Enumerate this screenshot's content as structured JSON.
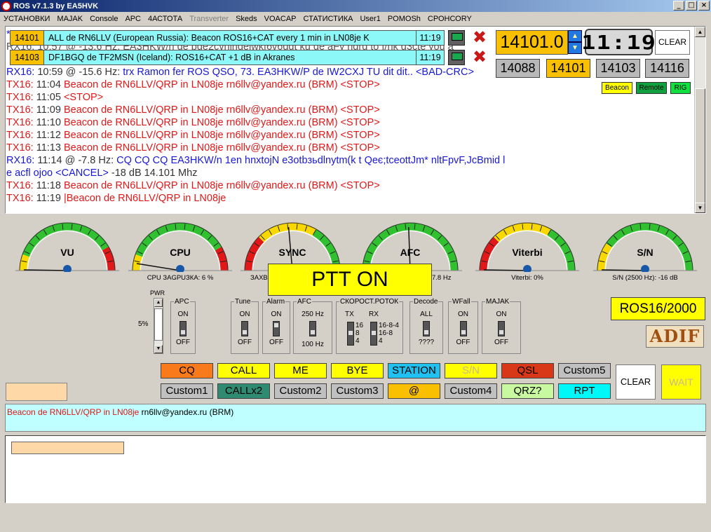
{
  "window": {
    "title": "ROS v7.1.3 by EA5HVK",
    "min": "_",
    "max": "□",
    "close": "×"
  },
  "menu": [
    "УСТАНОВКИ",
    "MAJAK",
    "Console",
    "АРС",
    "4АСТОТА",
    "Transverter",
    "Skeds",
    "VOACAP",
    "СТАТИСТИКА",
    "User1",
    "POMOSh",
    "СРОНСОRY"
  ],
  "callrows": [
    {
      "freq": "14101",
      "text": "ALL de RN6LLV (European Russia): Beacon ROS16+CAT every 1 min in LN08je K",
      "time": "11:19"
    },
    {
      "freq": "14103",
      "text": "DF1BGQ de TF2MSN (Iceland): ROS16+CAT +1 dB in Akranes",
      "time": "11:19"
    }
  ],
  "rx_lines": [
    [
      {
        "t": "*ᴛ",
        "c": "c-blue"
      },
      {
        "t": "                                                                                                                                   ",
        "c": "c-blue"
      }
    ],
    [
      {
        "t": "RX16: 10:57 @ -13.6 Hz: EA3HKW/n  de bde2cvnlndejwkf6v6dqt ku de aFy ndrd to   f/nk d3cte you a",
        "c": "c-bg"
      }
    ],
    [
      {
        "t": "RX16:",
        "c": "c-blue"
      },
      {
        "t": " 10:59 @ -15.6 Hz: ",
        "c": "c-dark"
      },
      {
        "t": "trx Ramon fer ROS QSO, 73. EA3HKW/P de IW2CXJ TU dit dit.. <BAD-CRC>",
        "c": "c-blue"
      }
    ],
    [
      {
        "t": "TX16:",
        "c": "c-red"
      },
      {
        "t": " 11:04 ",
        "c": "c-dark"
      },
      {
        "t": "Beacon de RN6LLV/QRP in LN08je rn6llv@yandex.ru (BRM) <STOP>",
        "c": "c-red"
      }
    ],
    [
      {
        "t": "TX16:",
        "c": "c-red"
      },
      {
        "t": " 11:05  ",
        "c": "c-dark"
      },
      {
        "t": "<STOP>",
        "c": "c-red"
      }
    ],
    [
      {
        "t": "TX16:",
        "c": "c-red"
      },
      {
        "t": " 11:09 ",
        "c": "c-dark"
      },
      {
        "t": "Beacon de RN6LLV/QRP in LN08je rn6llv@yandex.ru (BRM) <STOP>",
        "c": "c-red"
      }
    ],
    [
      {
        "t": "TX16:",
        "c": "c-red"
      },
      {
        "t": " 11:10 ",
        "c": "c-dark"
      },
      {
        "t": "Beacon de RN6LLV/QRP in LN08je rn6llv@yandex.ru (BRM) <STOP>",
        "c": "c-red"
      }
    ],
    [
      {
        "t": "TX16:",
        "c": "c-red"
      },
      {
        "t": " 11:12 ",
        "c": "c-dark"
      },
      {
        "t": "Beacon de RN6LLV/QRP in LN08je rn6llv@yandex.ru (BRM) <STOP>",
        "c": "c-red"
      }
    ],
    [
      {
        "t": "TX16:",
        "c": "c-red"
      },
      {
        "t": " 11:13 ",
        "c": "c-dark"
      },
      {
        "t": "Beacon de RN6LLV/QRP in LN08je rn6llv@yandex.ru (BRM) <STOP>",
        "c": "c-red"
      }
    ],
    [
      {
        "t": "RX16:",
        "c": "c-blue"
      },
      {
        "t": " 11:14 @ -7.8 Hz: ",
        "c": "c-dark"
      },
      {
        "t": "CQ CQ CQ EA3HKW/n 1en  hnxtojN e3otbзьdlnytm(k t Qeє;tceottJm*  nltFpvF,JcBmid l",
        "c": "c-blue"
      }
    ],
    [
      {
        "t": " e acfl ojoo   <CANCEL>",
        "c": "c-blue"
      },
      {
        "t": " -18 dB  14.101 Mhz",
        "c": "c-dark"
      }
    ],
    [
      {
        "t": "TX16:",
        "c": "c-red"
      },
      {
        "t": " 11:18 ",
        "c": "c-dark"
      },
      {
        "t": "Beacon de RN6LLV/QRP in LN08je rn6llv@yandex.ru (BRM) <STOP>",
        "c": "c-red"
      }
    ],
    [
      {
        "t": "TX16:",
        "c": "c-red"
      },
      {
        "t": " 11:19 ",
        "c": "c-dark"
      },
      {
        "t": "|Beacon de RN6LLV/QRP in LN08je",
        "c": "c-red"
      }
    ]
  ],
  "radio": {
    "frequency": "14101.0",
    "clock": "11:19",
    "clear": "CLEAR",
    "presets": [
      "14088",
      "14101",
      "14103",
      "14116"
    ],
    "indicators": [
      "Beacon",
      "Remote",
      "RIG"
    ]
  },
  "meters": [
    {
      "title": "VU",
      "caption": ""
    },
    {
      "title": "CPU",
      "caption": "CPU ЗАGРUЗКА: 6 %"
    },
    {
      "title": "SYNC",
      "caption": "ЗАХВ"
    },
    {
      "title": "AFC",
      "caption": "7.8 Hz"
    },
    {
      "title": "Viterbi",
      "caption": "Viterbi: 0%"
    },
    {
      "title": "S/N",
      "caption": "S/N (2500 Hz): -16 dB"
    }
  ],
  "ptt": "PTT ON",
  "pwr": {
    "label": "PWR",
    "value": "5%"
  },
  "switches": [
    {
      "title": "APC",
      "on": "ON",
      "off": "OFF"
    },
    {
      "title": "Tune",
      "on": "ON",
      "off": "OFF"
    },
    {
      "title": "Alarm",
      "on": "ON",
      "off": "OFF"
    },
    {
      "title": "AFC",
      "on": "250 Hz",
      "off": "100 Hz"
    },
    {
      "title": "СКОРОСТ.РОТОК",
      "tx": "TX",
      "rx": "RX",
      "tx_vals": [
        "16",
        "8",
        "4"
      ],
      "rx_vals": [
        "16-8-4",
        "16-8",
        "4"
      ]
    },
    {
      "title": "Decode",
      "on": "ALL",
      "off": "????"
    },
    {
      "title": "WFall",
      "on": "ON",
      "off": "OFF"
    },
    {
      "title": "MAJAK",
      "on": "ON",
      "off": "OFF"
    }
  ],
  "mode": "ROS16/2000",
  "adif": "ADIF",
  "macros_row1": [
    "CQ",
    "CALL",
    "ME",
    "BYE",
    "STATION",
    "S/N",
    "QSL",
    "Custom5"
  ],
  "macros_row2": [
    "Custom1",
    "CALLx2",
    "Custom2",
    "Custom3",
    "@",
    "Custom4",
    "QRZ?",
    "RPT"
  ],
  "clear_big": "CLEAR",
  "wait": "WAIT",
  "tx_line": {
    "red": "Beacon de RN6LLV/QRP in LN08je",
    "rest": " rn6llv@yandex.ru (BRM)"
  },
  "colors": {
    "gold": "#f8c000",
    "cyan": "#8cf8f8",
    "yellow": "#ffff00",
    "orange": "#f87a1a",
    "teal": "#2e8a70",
    "blue": "#20c0f0",
    "brick": "#d83818",
    "lightgreen": "#c8f8a0",
    "aqua": "#00f8f8",
    "grey": "#c0c0c0"
  }
}
